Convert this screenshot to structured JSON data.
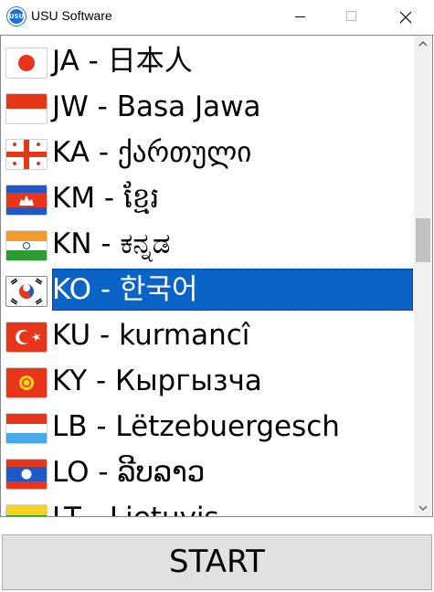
{
  "window": {
    "title": "USU Software",
    "icon_text": "USU"
  },
  "languages": [
    {
      "label": "JA - 日本人",
      "flag": "japan"
    },
    {
      "label": "JW - Basa Jawa",
      "flag": "indonesia"
    },
    {
      "label": "KA - ქართული",
      "flag": "georgia"
    },
    {
      "label": "KM - ខ្មែរ",
      "flag": "cambodia"
    },
    {
      "label": "KN - ಕನ್ನಡ",
      "flag": "india"
    },
    {
      "label": "KO - 한국어",
      "flag": "korea",
      "selected": true
    },
    {
      "label": "KU - kurmancî",
      "flag": "turkey"
    },
    {
      "label": "KY - Кыргызча",
      "flag": "kyrgyzstan"
    },
    {
      "label": "LB - Lëtzebuergesch",
      "flag": "luxembourg"
    },
    {
      "label": "LO - ລີບລາວ",
      "flag": "laos"
    },
    {
      "label": "LT - Lietuvis",
      "flag": "lithuania"
    }
  ],
  "start_button": {
    "label": "START"
  },
  "colors": {
    "selection": "#0a64c8",
    "button_bg": "#e1e1e1"
  }
}
